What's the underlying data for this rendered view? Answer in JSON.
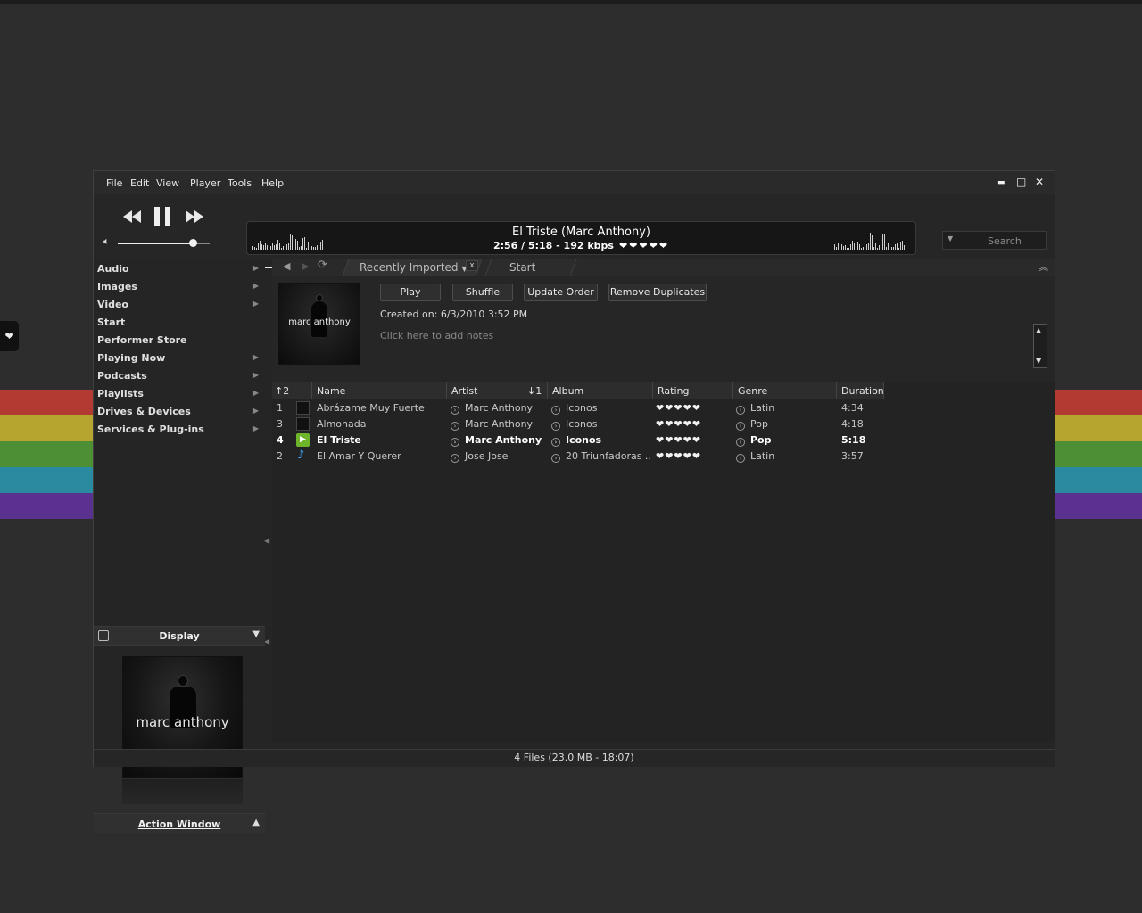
{
  "window": {
    "menu": [
      "File",
      "Edit",
      "View",
      "Player",
      "Tools",
      "Help"
    ],
    "controls": {
      "minimize": "▬",
      "maximize": "□",
      "close": "✕"
    }
  },
  "player": {
    "now_playing_title": "El Triste (Marc Anthony)",
    "now_playing_info": "2:56 / 5:18 - 192 kbps",
    "now_playing_rating": "❤❤❤❤❤",
    "rating_value": 5,
    "volume_fraction": 0.82,
    "seek_fraction": 0.55,
    "search_placeholder": "Search",
    "icons": {
      "prev": "previous-icon",
      "pause": "pause-icon",
      "next": "next-icon",
      "volume": "volume-icon",
      "repeat": "repeat-icon",
      "shuffle": "shuffle-icon",
      "equalizer": "equalizer-icon"
    }
  },
  "sidebar": {
    "items": [
      {
        "label": "Audio",
        "arrow": true
      },
      {
        "label": "Images",
        "arrow": true
      },
      {
        "label": "Video",
        "arrow": true
      },
      {
        "label": "Start",
        "arrow": false
      },
      {
        "label": "Performer Store",
        "arrow": false
      },
      {
        "label": "Playing Now",
        "arrow": true
      },
      {
        "label": "Podcasts",
        "arrow": true
      },
      {
        "label": "Playlists",
        "arrow": true
      },
      {
        "label": "Drives & Devices",
        "arrow": true
      },
      {
        "label": "Services & Plug-ins",
        "arrow": true
      }
    ],
    "display_title": "Display",
    "action_window": "Action Window",
    "art_text": "marc anthony"
  },
  "tabs": {
    "active": "Recently Imported",
    "close": "x",
    "second": "Start"
  },
  "playlist": {
    "buttons": {
      "play": "Play",
      "shuffle": "Shuffle",
      "update": "Update Order",
      "dedupe": "Remove Duplicates"
    },
    "created": "Created on: 6/3/2010 3:52 PM",
    "notes_placeholder": "Click here to add notes",
    "columns": {
      "sort": "↑2",
      "name": "Name",
      "artist": "Artist",
      "artist_sort": "↓1",
      "album": "Album",
      "rating": "Rating",
      "genre": "Genre",
      "duration": "Duration"
    },
    "rows": [
      {
        "num": "1",
        "name": "Abrázame Muy Fuerte",
        "artist": "Marc Anthony",
        "album": "Iconos",
        "rating": "❤❤❤❤❤",
        "genre": "Latin",
        "duration": "4:34",
        "icon": "album-thumb-icon",
        "playing": false
      },
      {
        "num": "3",
        "name": "Almohada",
        "artist": "Marc Anthony",
        "album": "Iconos",
        "rating": "❤❤❤❤❤",
        "genre": "Pop",
        "duration": "4:18",
        "icon": "album-thumb-icon",
        "playing": false
      },
      {
        "num": "4",
        "name": "El Triste",
        "artist": "Marc Anthony",
        "album": "Iconos",
        "rating": "❤❤❤❤❤",
        "genre": "Pop",
        "duration": "5:18",
        "icon": "now-playing-icon",
        "playing": true
      },
      {
        "num": "2",
        "name": "El Amar Y Querer",
        "artist": "Jose Jose",
        "album": "20 Triunfadoras ...",
        "rating": "❤❤❤❤❤",
        "genre": "Latin",
        "duration": "3:57",
        "icon": "music-note-icon",
        "playing": false
      }
    ]
  },
  "status": "4 Files (23.0 MB - 18:07)",
  "colors": {
    "background": "#2d2d2d",
    "window": "#252525",
    "stripes": [
      "#b23a32",
      "#b6a62f",
      "#4d8f35",
      "#2a8aa0",
      "#5a318f"
    ],
    "play_green": "#6fb52c",
    "note_blue": "#3fa8ff"
  }
}
